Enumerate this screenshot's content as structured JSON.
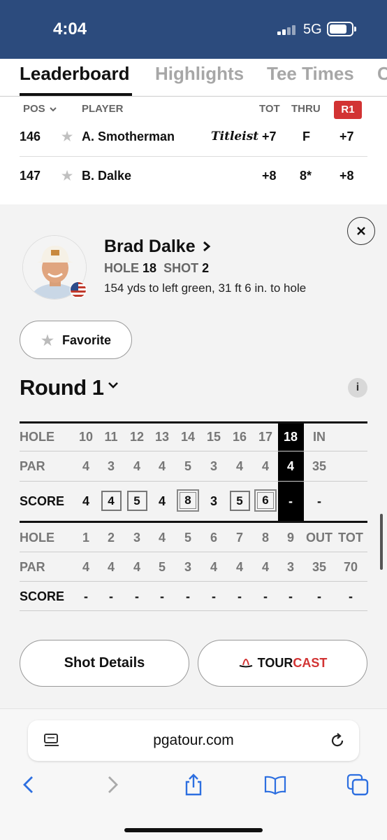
{
  "status": {
    "time": "4:04",
    "network": "5G"
  },
  "tabs": [
    {
      "label": "Leaderboard"
    },
    {
      "label": "Highlights"
    },
    {
      "label": "Tee Times"
    },
    {
      "label": "C"
    }
  ],
  "leaderboard": {
    "headers": {
      "pos": "POS",
      "player": "PLAYER",
      "tot": "TOT",
      "thru": "THRU",
      "round": "R1"
    },
    "rows": [
      {
        "pos": "146",
        "player": "A. Smotherman",
        "sponsor": "Titleist",
        "tot": "+7",
        "thru": "F",
        "round": "+7"
      },
      {
        "pos": "147",
        "player": "B. Dalke",
        "sponsor": "",
        "tot": "+8",
        "thru": "8*",
        "round": "+8"
      }
    ]
  },
  "player_panel": {
    "name": "Brad Dalke",
    "hole_label": "HOLE",
    "hole": "18",
    "shot_label": "SHOT",
    "shot": "2",
    "shot_desc": "154 yds to left green, 31 ft 6 in. to hole",
    "favorite_label": "Favorite",
    "round_label": "Round 1"
  },
  "scorecard": {
    "labels": {
      "hole": "HOLE",
      "par": "PAR",
      "score": "SCORE"
    },
    "back": {
      "holes": [
        "10",
        "11",
        "12",
        "13",
        "14",
        "15",
        "16",
        "17",
        "18",
        "IN"
      ],
      "par": [
        "4",
        "3",
        "4",
        "4",
        "5",
        "3",
        "4",
        "4",
        "4",
        "35"
      ],
      "score": [
        "4",
        "4",
        "5",
        "4",
        "8",
        "3",
        "5",
        "6",
        "-",
        "-"
      ]
    },
    "front": {
      "holes": [
        "1",
        "2",
        "3",
        "4",
        "5",
        "6",
        "7",
        "8",
        "9",
        "OUT",
        "TOT"
      ],
      "par": [
        "4",
        "4",
        "4",
        "5",
        "3",
        "4",
        "4",
        "4",
        "3",
        "35",
        "70"
      ],
      "score": [
        "-",
        "-",
        "-",
        "-",
        "-",
        "-",
        "-",
        "-",
        "-",
        "-",
        "-"
      ]
    }
  },
  "buttons": {
    "shot_details": "Shot Details",
    "tourcast_a": "TOUR",
    "tourcast_b": "CAST"
  },
  "browser": {
    "url": "pgatour.com"
  },
  "colors": {
    "status_bar": "#2c4b7d",
    "accent_red": "#d23333"
  }
}
